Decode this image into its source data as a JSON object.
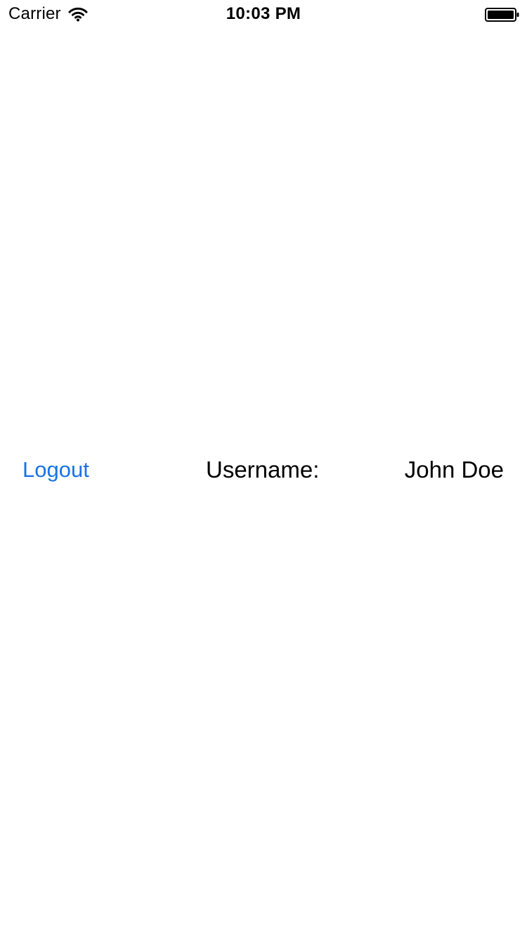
{
  "status_bar": {
    "carrier": "Carrier",
    "time": "10:03 PM",
    "wifi_icon": "wifi-icon",
    "battery_icon": "battery-icon"
  },
  "profile": {
    "logout_label": "Logout",
    "username_label": "Username:",
    "username_value": "John Doe"
  },
  "colors": {
    "background": "#ffffff",
    "text": "#000000",
    "link": "#1a73e8"
  }
}
